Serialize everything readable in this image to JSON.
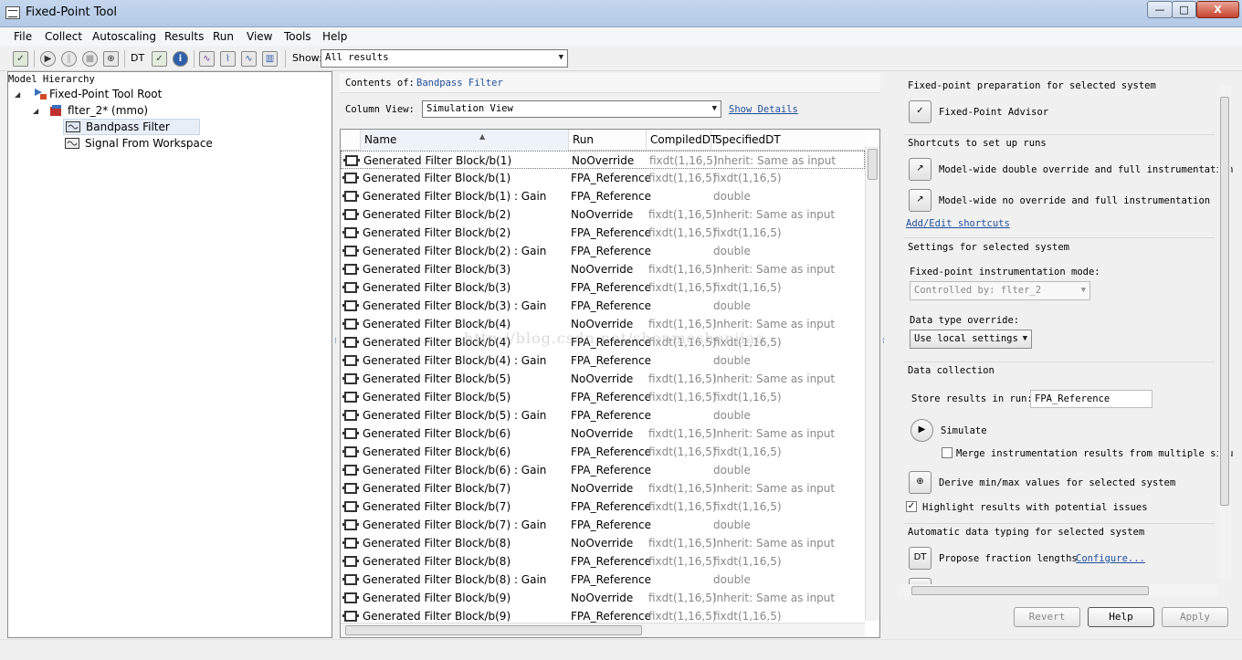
{
  "window": {
    "title": "Fixed-Point Tool",
    "min_glyph": "—",
    "max_glyph": "□",
    "close_glyph": "X"
  },
  "menu": [
    "File",
    "Collect",
    "Autoscaling",
    "Results",
    "Run",
    "View",
    "Tools",
    "Help"
  ],
  "toolbar": {
    "dt_label": "DT",
    "show_label": "Show:",
    "show_value": "All results"
  },
  "model_hierarchy": {
    "title": "Model Hierarchy",
    "nodes": [
      {
        "label": "Fixed-Point Tool Root",
        "level": 0
      },
      {
        "label": "flter_2* (mmo)",
        "level": 1
      },
      {
        "label": "Bandpass Filter",
        "level": 2,
        "selected": true
      },
      {
        "label": "Signal From Workspace",
        "level": 2
      }
    ]
  },
  "contents": {
    "label": "Contents of:",
    "value": "Bandpass Filter"
  },
  "column_view": {
    "label": "Column View:",
    "value": "Simulation View",
    "show_details": "Show Details"
  },
  "table": {
    "headers": [
      "Name",
      "Run",
      "CompiledDT",
      "SpecifiedDT"
    ],
    "rows": [
      [
        "Generated Filter Block/b(1)",
        "NoOverride",
        "fixdt(1,16,5)",
        "Inherit: Same as input"
      ],
      [
        "Generated Filter Block/b(1)",
        "FPA_Reference",
        "fixdt(1,16,5)",
        "fixdt(1,16,5)"
      ],
      [
        "Generated Filter Block/b(1) : Gain",
        "FPA_Reference",
        "",
        "double"
      ],
      [
        "Generated Filter Block/b(2)",
        "NoOverride",
        "fixdt(1,16,5)",
        "Inherit: Same as input"
      ],
      [
        "Generated Filter Block/b(2)",
        "FPA_Reference",
        "fixdt(1,16,5)",
        "fixdt(1,16,5)"
      ],
      [
        "Generated Filter Block/b(2) : Gain",
        "FPA_Reference",
        "",
        "double"
      ],
      [
        "Generated Filter Block/b(3)",
        "NoOverride",
        "fixdt(1,16,5)",
        "Inherit: Same as input"
      ],
      [
        "Generated Filter Block/b(3)",
        "FPA_Reference",
        "fixdt(1,16,5)",
        "fixdt(1,16,5)"
      ],
      [
        "Generated Filter Block/b(3) : Gain",
        "FPA_Reference",
        "",
        "double"
      ],
      [
        "Generated Filter Block/b(4)",
        "NoOverride",
        "fixdt(1,16,5)",
        "Inherit: Same as input"
      ],
      [
        "Generated Filter Block/b(4)",
        "FPA_Reference",
        "fixdt(1,16,5)",
        "fixdt(1,16,5)"
      ],
      [
        "Generated Filter Block/b(4) : Gain",
        "FPA_Reference",
        "",
        "double"
      ],
      [
        "Generated Filter Block/b(5)",
        "NoOverride",
        "fixdt(1,16,5)",
        "Inherit: Same as input"
      ],
      [
        "Generated Filter Block/b(5)",
        "FPA_Reference",
        "fixdt(1,16,5)",
        "fixdt(1,16,5)"
      ],
      [
        "Generated Filter Block/b(5) : Gain",
        "FPA_Reference",
        "",
        "double"
      ],
      [
        "Generated Filter Block/b(6)",
        "NoOverride",
        "fixdt(1,16,5)",
        "Inherit: Same as input"
      ],
      [
        "Generated Filter Block/b(6)",
        "FPA_Reference",
        "fixdt(1,16,5)",
        "fixdt(1,16,5)"
      ],
      [
        "Generated Filter Block/b(6) : Gain",
        "FPA_Reference",
        "",
        "double"
      ],
      [
        "Generated Filter Block/b(7)",
        "NoOverride",
        "fixdt(1,16,5)",
        "Inherit: Same as input"
      ],
      [
        "Generated Filter Block/b(7)",
        "FPA_Reference",
        "fixdt(1,16,5)",
        "fixdt(1,16,5)"
      ],
      [
        "Generated Filter Block/b(7) : Gain",
        "FPA_Reference",
        "",
        "double"
      ],
      [
        "Generated Filter Block/b(8)",
        "NoOverride",
        "fixdt(1,16,5)",
        "Inherit: Same as input"
      ],
      [
        "Generated Filter Block/b(8)",
        "FPA_Reference",
        "fixdt(1,16,5)",
        "fixdt(1,16,5)"
      ],
      [
        "Generated Filter Block/b(8) : Gain",
        "FPA_Reference",
        "",
        "double"
      ],
      [
        "Generated Filter Block/b(9)",
        "NoOverride",
        "fixdt(1,16,5)",
        "Inherit: Same as input"
      ],
      [
        "Generated Filter Block/b(9)",
        "FPA_Reference",
        "fixdt(1,16,5)",
        "fixdt(1,16,5)"
      ]
    ]
  },
  "watermark": "http://blog.csdn.net/shenmeshenjiao",
  "right_panel": {
    "prep_title": "Fixed-point preparation for selected system",
    "advisor_label": "Fixed-Point Advisor",
    "shortcuts_title": "Shortcuts to set up runs",
    "shortcut1": "Model-wide double override and full instrumentation",
    "shortcut2": "Model-wide no override and full instrumentation",
    "edit_shortcuts": "Add/Edit shortcuts",
    "settings_title": "Settings for selected system",
    "instr_mode_label": "Fixed-point instrumentation mode:",
    "instr_mode_value": "Controlled by: flter_2",
    "dto_label": "Data type override:",
    "dto_value": "Use local settings",
    "collection_title": "Data collection",
    "store_label": "Store results in run:",
    "store_value": "FPA_Reference",
    "simulate_label": "Simulate",
    "merge_label": "Merge instrumentation results from multiple simulations",
    "merge_checked": false,
    "derive_label": "Derive min/max values for selected system",
    "highlight_label": "Highlight results with potential issues",
    "highlight_checked": true,
    "auto_title": "Automatic data typing for selected system",
    "dt_button": "DT",
    "propose_label": "Propose fraction lengths",
    "configure_link": "Configure..."
  },
  "buttons": {
    "revert": "Revert",
    "help": "Help",
    "apply": "Apply"
  }
}
